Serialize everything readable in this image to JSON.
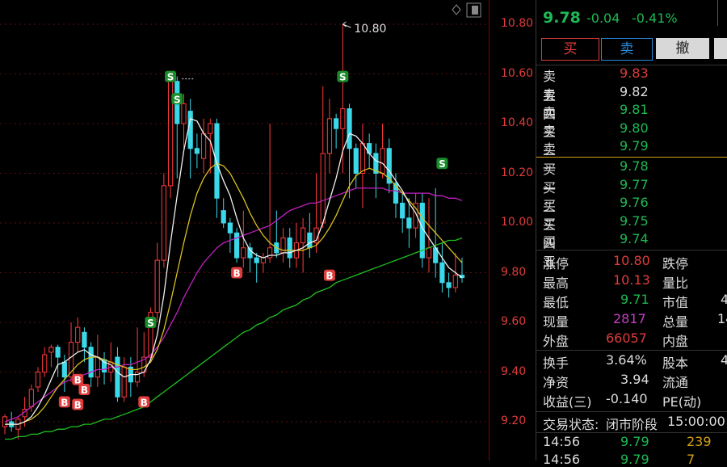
{
  "axis": {
    "ticks": [
      "10.80",
      "10.60",
      "10.40",
      "10.20",
      "10.00",
      "9.80",
      "9.60",
      "9.40",
      "9.20"
    ],
    "top_annotation": "10.80"
  },
  "quote": {
    "price": "9.78",
    "change": "-0.04",
    "change_pct": "-0.41%"
  },
  "buttons": {
    "buy": "买",
    "sell": "卖",
    "cancel": "撤"
  },
  "order_book": {
    "asks": [
      {
        "label": "卖五",
        "price": "9.83",
        "color": "#e03c3c"
      },
      {
        "label": "卖四",
        "price": "9.82",
        "color": "#dddddd"
      },
      {
        "label": "卖三",
        "price": "9.81",
        "color": "#1db954"
      },
      {
        "label": "卖二",
        "price": "9.80",
        "color": "#1db954"
      },
      {
        "label": "卖一",
        "price": "9.79",
        "color": "#1db954"
      }
    ],
    "bids": [
      {
        "label": "买一",
        "price": "9.78",
        "color": "#1db954"
      },
      {
        "label": "买二",
        "price": "9.77",
        "color": "#1db954"
      },
      {
        "label": "买三",
        "price": "9.76",
        "color": "#1db954"
      },
      {
        "label": "买四",
        "price": "9.75",
        "color": "#1db954"
      },
      {
        "label": "买五",
        "price": "9.74",
        "color": "#1db954"
      }
    ]
  },
  "stats": {
    "limit_up_label": "涨停",
    "limit_up": "10.80",
    "limit_down_label": "跌停",
    "high_label": "最高",
    "high": "10.13",
    "ratio_label": "量比",
    "low_label": "最低",
    "low": "9.71",
    "mktcap_label": "市值",
    "mktcap_frag": "4",
    "cur_vol_label": "现量",
    "cur_vol": "2817",
    "total_vol_label": "总量",
    "total_vol_frag": "14",
    "outer_label": "外盘",
    "outer": "66057",
    "inner_label": "内盘",
    "inner_frag": "",
    "turnover_label": "换手",
    "turnover": "3.64%",
    "equity_label": "股本",
    "equity_frag": "4",
    "nav_label": "净资",
    "nav": "3.94",
    "float_label": "流通",
    "float_frag": "",
    "eps_label": "收益(三)",
    "eps": "-0.140",
    "pe_label": "PE(动)"
  },
  "status": {
    "label": "交易状态:",
    "phase": "闭市阶段",
    "time": "15:00:00"
  },
  "trades": [
    {
      "time": "14:56",
      "price": "9.79",
      "vol": "239"
    },
    {
      "time": "14:56",
      "price": "9.79",
      "vol": "7"
    }
  ],
  "signals": [
    "S",
    "B"
  ],
  "chart_data": {
    "type": "candlestick",
    "ylim": [
      9.13,
      10.9
    ],
    "candles": [
      [
        9.18,
        9.22,
        9.15,
        9.23
      ],
      [
        9.2,
        9.18,
        9.16,
        9.24
      ],
      [
        9.17,
        9.21,
        9.13,
        9.22
      ],
      [
        9.22,
        9.25,
        9.18,
        9.3
      ],
      [
        9.26,
        9.33,
        9.24,
        9.35
      ],
      [
        9.34,
        9.4,
        9.32,
        9.42
      ],
      [
        9.4,
        9.47,
        9.38,
        9.5
      ],
      [
        9.48,
        9.5,
        9.42,
        9.51
      ],
      [
        9.5,
        9.46,
        9.38,
        9.51
      ],
      [
        9.44,
        9.38,
        9.32,
        9.47
      ],
      [
        9.38,
        9.52,
        9.36,
        9.6
      ],
      [
        9.52,
        9.58,
        9.48,
        9.62
      ],
      [
        9.56,
        9.5,
        9.44,
        9.58
      ],
      [
        9.5,
        9.38,
        9.34,
        9.52
      ],
      [
        9.38,
        9.46,
        9.34,
        9.55
      ],
      [
        9.45,
        9.4,
        9.35,
        9.48
      ],
      [
        9.4,
        9.44,
        9.36,
        9.52
      ],
      [
        9.46,
        9.3,
        9.28,
        9.5
      ],
      [
        9.3,
        9.42,
        9.28,
        9.46
      ],
      [
        9.42,
        9.36,
        9.3,
        9.46
      ],
      [
        9.36,
        9.4,
        9.34,
        9.58
      ],
      [
        9.4,
        9.46,
        9.38,
        9.56
      ],
      [
        9.46,
        9.64,
        9.44,
        9.66
      ],
      [
        9.64,
        9.85,
        9.6,
        9.92
      ],
      [
        9.85,
        10.15,
        9.82,
        10.2
      ],
      [
        10.15,
        10.57,
        10.1,
        10.59
      ],
      [
        10.57,
        10.4,
        10.18,
        10.59
      ],
      [
        10.4,
        10.48,
        10.3,
        10.52
      ],
      [
        10.45,
        10.3,
        10.18,
        10.5
      ],
      [
        10.3,
        10.28,
        10.22,
        10.36
      ],
      [
        10.26,
        10.36,
        10.2,
        10.42
      ],
      [
        10.36,
        10.4,
        10.2,
        10.42
      ],
      [
        10.4,
        10.1,
        10.02,
        10.42
      ],
      [
        10.05,
        10.0,
        9.98,
        10.1
      ],
      [
        10.0,
        9.96,
        9.88,
        10.02
      ],
      [
        9.96,
        9.86,
        9.84,
        9.98
      ],
      [
        9.86,
        9.9,
        9.82,
        10.05
      ],
      [
        9.9,
        9.86,
        9.8,
        9.92
      ],
      [
        9.86,
        9.84,
        9.76,
        9.88
      ],
      [
        9.84,
        9.86,
        9.8,
        9.88
      ],
      [
        9.86,
        9.9,
        9.84,
        10.4
      ],
      [
        9.92,
        9.88,
        9.86,
        10.05
      ],
      [
        9.88,
        9.94,
        9.84,
        9.98
      ],
      [
        9.94,
        9.86,
        9.82,
        9.98
      ],
      [
        9.86,
        9.92,
        9.82,
        10.0
      ],
      [
        9.92,
        9.98,
        9.8,
        10.02
      ],
      [
        9.96,
        9.9,
        9.86,
        10.04
      ],
      [
        9.92,
        9.98,
        9.88,
        10.2
      ],
      [
        10.0,
        10.28,
        9.98,
        10.55
      ],
      [
        10.28,
        10.42,
        10.2,
        10.5
      ],
      [
        10.42,
        10.38,
        10.3,
        10.44
      ],
      [
        10.38,
        10.46,
        10.2,
        10.8
      ],
      [
        10.46,
        10.3,
        10.1,
        10.48
      ],
      [
        10.3,
        10.2,
        10.14,
        10.32
      ],
      [
        10.2,
        10.32,
        10.06,
        10.4
      ],
      [
        10.32,
        10.28,
        10.22,
        10.36
      ],
      [
        10.28,
        10.2,
        10.1,
        10.32
      ],
      [
        10.2,
        10.3,
        10.18,
        10.4
      ],
      [
        10.3,
        10.16,
        10.12,
        10.34
      ],
      [
        10.16,
        10.08,
        10.02,
        10.2
      ],
      [
        10.08,
        10.02,
        9.96,
        10.12
      ],
      [
        10.02,
        9.98,
        9.9,
        10.1
      ],
      [
        9.98,
        10.08,
        9.94,
        10.12
      ],
      [
        10.08,
        9.86,
        9.82,
        10.12
      ],
      [
        9.86,
        9.9,
        9.8,
        10.1
      ],
      [
        9.9,
        9.84,
        9.78,
        10.14
      ],
      [
        9.84,
        9.76,
        9.72,
        9.92
      ],
      [
        9.76,
        9.74,
        9.7,
        9.8
      ],
      [
        9.74,
        9.79,
        9.72,
        9.88
      ],
      [
        9.79,
        9.78,
        9.76,
        9.86
      ]
    ],
    "ma_white": [
      9.19,
      9.19,
      9.19,
      9.2,
      9.22,
      9.26,
      9.31,
      9.37,
      9.43,
      9.44,
      9.46,
      9.48,
      9.49,
      9.47,
      9.46,
      9.44,
      9.43,
      9.4,
      9.38,
      9.39,
      9.39,
      9.4,
      9.45,
      9.55,
      9.71,
      9.92,
      10.11,
      10.29,
      10.42,
      10.41,
      10.36,
      10.33,
      10.24,
      10.17,
      10.11,
      10.02,
      9.94,
      9.89,
      9.87,
      9.86,
      9.87,
      9.87,
      9.88,
      9.88,
      9.89,
      9.9,
      9.92,
      9.93,
      10.0,
      10.09,
      10.18,
      10.29,
      10.36,
      10.35,
      10.32,
      10.28,
      10.25,
      10.24,
      10.21,
      10.17,
      10.13,
      10.08,
      10.04,
      9.98,
      9.94,
      9.9,
      9.86,
      9.82,
      9.8,
      9.78
    ],
    "ma_yellow": [
      9.19,
      9.19,
      9.19,
      9.2,
      9.21,
      9.23,
      9.26,
      9.3,
      9.34,
      9.37,
      9.4,
      9.43,
      9.45,
      9.46,
      9.46,
      9.45,
      9.44,
      9.43,
      9.42,
      9.41,
      9.41,
      9.42,
      9.44,
      9.49,
      9.57,
      9.68,
      9.8,
      9.92,
      10.03,
      10.12,
      10.18,
      10.22,
      10.24,
      10.23,
      10.2,
      10.15,
      10.1,
      10.04,
      9.99,
      9.95,
      9.92,
      9.9,
      9.89,
      9.89,
      9.89,
      9.89,
      9.9,
      9.91,
      9.94,
      9.98,
      10.03,
      10.09,
      10.15,
      10.19,
      10.21,
      10.22,
      10.21,
      10.2,
      10.18,
      10.15,
      10.12,
      10.09,
      10.06,
      10.02,
      9.99,
      9.96,
      9.93,
      9.9,
      9.87,
      9.84
    ],
    "ma_magenta": [
      9.2,
      9.21,
      9.22,
      9.24,
      9.26,
      9.28,
      9.3,
      9.32,
      9.34,
      9.36,
      9.37,
      9.38,
      9.39,
      9.4,
      9.41,
      9.41,
      9.42,
      9.42,
      9.43,
      9.43,
      9.44,
      9.45,
      9.47,
      9.5,
      9.54,
      9.59,
      9.64,
      9.7,
      9.75,
      9.8,
      9.84,
      9.87,
      9.9,
      9.92,
      9.93,
      9.94,
      9.95,
      9.96,
      9.97,
      9.98,
      9.99,
      10.01,
      10.03,
      10.05,
      10.06,
      10.07,
      10.08,
      10.08,
      10.09,
      10.1,
      10.11,
      10.12,
      10.13,
      10.14,
      10.14,
      10.14,
      10.14,
      10.14,
      10.13,
      10.13,
      10.12,
      10.12,
      10.12,
      10.12,
      10.12,
      10.11,
      10.11,
      10.1,
      10.1,
      10.09
    ],
    "ma_green": [
      9.13,
      9.13,
      9.14,
      9.14,
      9.15,
      9.15,
      9.16,
      9.16,
      9.17,
      9.17,
      9.18,
      9.18,
      9.19,
      9.19,
      9.2,
      9.21,
      9.21,
      9.22,
      9.23,
      9.24,
      9.25,
      9.26,
      9.28,
      9.3,
      9.32,
      9.34,
      9.36,
      9.38,
      9.4,
      9.42,
      9.44,
      9.46,
      9.48,
      9.5,
      9.52,
      9.54,
      9.56,
      9.57,
      9.59,
      9.6,
      9.62,
      9.63,
      9.65,
      9.66,
      9.67,
      9.69,
      9.7,
      9.72,
      9.73,
      9.74,
      9.76,
      9.77,
      9.78,
      9.79,
      9.8,
      9.81,
      9.82,
      9.83,
      9.84,
      9.85,
      9.86,
      9.87,
      9.88,
      9.89,
      9.9,
      9.91,
      9.92,
      9.93,
      9.93,
      9.94
    ],
    "sell_signals": [
      25,
      26,
      51,
      66,
      22
    ],
    "buy_signals": [
      11,
      12,
      11,
      21,
      35,
      49,
      9
    ]
  }
}
